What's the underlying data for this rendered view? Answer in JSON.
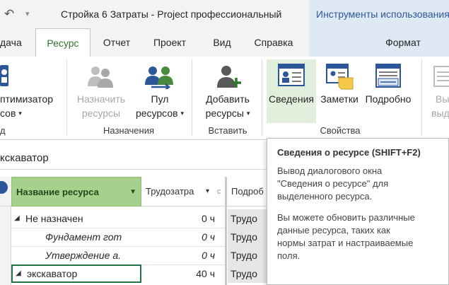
{
  "title_bar": {
    "back_arrow": "↶",
    "dropdown_arrow": "▾",
    "window_title": "Стройка 6 Затраты  -  Project профессиональный",
    "contextual_tools_label": "Инструменты использования"
  },
  "tabs": {
    "task_partial": "дача",
    "resource": "Ресурс",
    "report": "Отчет",
    "project": "Проект",
    "view": "Вид",
    "help": "Справка",
    "format": "Формат"
  },
  "ribbon": {
    "leveling": {
      "line1": "птимизатор",
      "line2": "сов"
    },
    "leveling_group_partial": "д",
    "assign": {
      "line1": "Назначить",
      "line2": "ресурсы"
    },
    "pool": {
      "line1": "Пул",
      "line2": "ресурсов"
    },
    "assignments_group": "Назначения",
    "add": {
      "line1": "Добавить",
      "line2": "ресурсы"
    },
    "insert_group": "Вставить",
    "info": "Сведения",
    "notes": "Заметки",
    "details": "Подробно",
    "properties_group": "Свойства",
    "leveling_right": {
      "line1": "Вы",
      "line2": "выд"
    }
  },
  "entry_bar": {
    "value": "кскаватор"
  },
  "grid": {
    "headers": {
      "name": "Название ресурса",
      "work": "Трудозатра",
      "details": "Подроб"
    },
    "rows": [
      {
        "name": "Не назначен",
        "work": "0 ч",
        "detail": "Трудо"
      },
      {
        "name": "Фундамент гот",
        "work": "0 ч",
        "detail": "Трудо"
      },
      {
        "name": "Утверждение а.",
        "work": "0 ч",
        "detail": "Трудо"
      },
      {
        "name": "экскаватор",
        "work": "40 ч",
        "detail": "Трудо"
      }
    ]
  },
  "tooltip": {
    "title": "Сведения о ресурсе (SHIFT+F2)",
    "para1": [
      "Вывод диалогового окна",
      "\"Сведения о ресурсе\" для",
      "выделенного ресурса."
    ],
    "para2": [
      "Вы можете обновить различные",
      "данные ресурса, таких как",
      "нормы затрат и настраиваемые",
      "поля."
    ]
  },
  "colors": {
    "accent_green": "#31752f",
    "header_green": "#a6d08b",
    "selected_border": "#217346",
    "tools_blue": "#2b579a"
  }
}
